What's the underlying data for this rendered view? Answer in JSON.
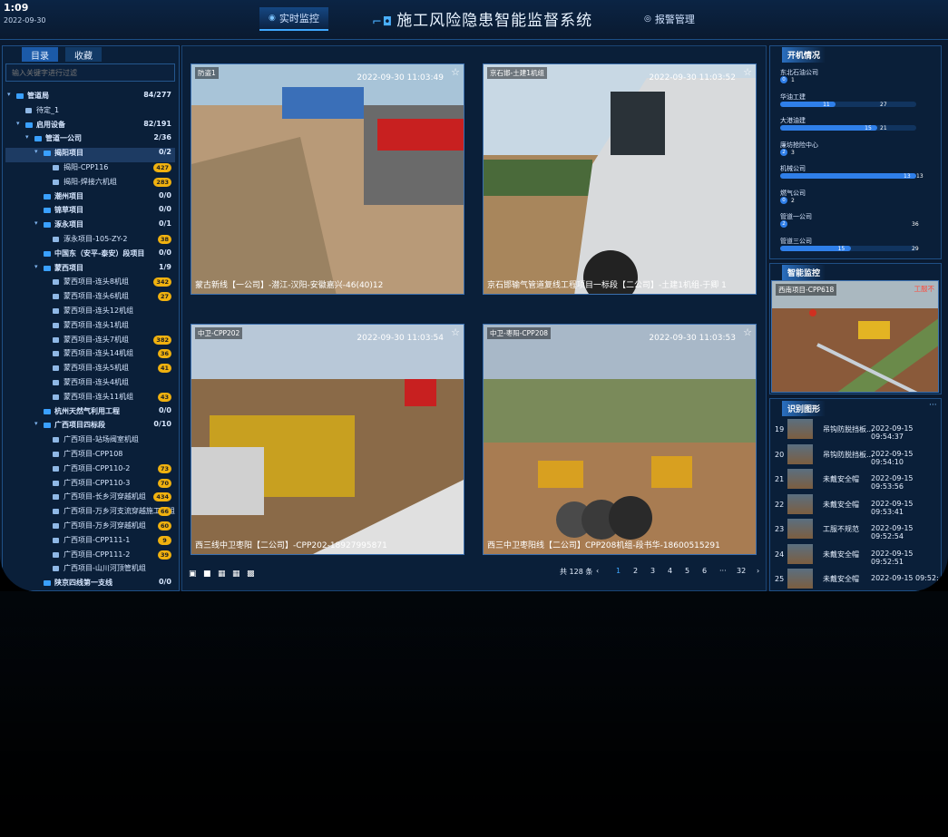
{
  "clock": {
    "time": "1:09",
    "date": "2022-09-30"
  },
  "nav": {
    "realtime": "实时监控",
    "alarm": "报警管理"
  },
  "app_title": "施工风险隐患智能监督系统",
  "left": {
    "tabs": [
      "目录",
      "收藏"
    ],
    "filter_placeholder": "输入关键字进行过滤",
    "tree": [
      {
        "label": "管道局",
        "count": "84/277",
        "level": 0,
        "caret": true
      },
      {
        "label": "待定_1",
        "level": 1,
        "leaf": true
      },
      {
        "label": "启用设备",
        "count": "82/191",
        "level": 1,
        "caret": true
      },
      {
        "label": "管道一公司",
        "count": "2/36",
        "level": 2,
        "caret": true
      },
      {
        "label": "揭阳项目",
        "count": "0/2",
        "level": 3,
        "caret": true,
        "selected": true
      },
      {
        "label": "揭阳-CPP116",
        "badge": "427",
        "level": 4,
        "leaf": true
      },
      {
        "label": "揭阳-焊接六机组",
        "badge": "283",
        "level": 4,
        "leaf": true
      },
      {
        "label": "潮州项目",
        "count": "0/0",
        "level": 3
      },
      {
        "label": "锦草项目",
        "count": "0/0",
        "level": 3
      },
      {
        "label": "涿永项目",
        "count": "0/1",
        "level": 3,
        "caret": true
      },
      {
        "label": "涿永项目-105-ZY-2",
        "badge": "38",
        "level": 4,
        "leaf": true
      },
      {
        "label": "中国东（安平-泰安）段项目",
        "count": "0/0",
        "level": 3
      },
      {
        "label": "蒙西项目",
        "count": "1/9",
        "level": 3,
        "caret": true
      },
      {
        "label": "蒙西项目-连头8机组",
        "badge": "342",
        "level": 4,
        "leaf": true
      },
      {
        "label": "蒙西项目-连头6机组",
        "badge": "27",
        "level": 4,
        "leaf": true
      },
      {
        "label": "蒙西项目-连头12机组",
        "level": 4,
        "leaf": true
      },
      {
        "label": "蒙西项目-连头1机组",
        "level": 4,
        "leaf": true
      },
      {
        "label": "蒙西项目-连头7机组",
        "badge": "382",
        "level": 4,
        "leaf": true
      },
      {
        "label": "蒙西项目-连头14机组",
        "badge": "36",
        "level": 4,
        "leaf": true
      },
      {
        "label": "蒙西项目-连头5机组",
        "badge": "41",
        "level": 4,
        "leaf": true
      },
      {
        "label": "蒙西项目-连头4机组",
        "level": 4,
        "leaf": true
      },
      {
        "label": "蒙西项目-连头11机组",
        "badge": "43",
        "level": 4,
        "leaf": true
      },
      {
        "label": "杭州天然气利用工程",
        "count": "0/0",
        "level": 3
      },
      {
        "label": "广西项目四标段",
        "count": "0/10",
        "level": 3,
        "caret": true
      },
      {
        "label": "广西项目-站场阀室机组",
        "level": 4,
        "leaf": true
      },
      {
        "label": "广西项目-CPP108",
        "level": 4,
        "leaf": true
      },
      {
        "label": "广西项目-CPP110-2",
        "badge": "73",
        "level": 4,
        "leaf": true
      },
      {
        "label": "广西项目-CPP110-3",
        "badge": "70",
        "level": 4,
        "leaf": true
      },
      {
        "label": "广西项目-长乡河穿越机组",
        "badge": "434",
        "level": 4,
        "leaf": true
      },
      {
        "label": "广西项目-万乡河支流穿越施工机组",
        "badge": "66",
        "level": 4,
        "leaf": true
      },
      {
        "label": "广西项目-万乡河穿越机组",
        "badge": "60",
        "level": 4,
        "leaf": true
      },
      {
        "label": "广西项目-CPP111-1",
        "badge": "9",
        "level": 4,
        "leaf": true
      },
      {
        "label": "广西项目-CPP111-2",
        "badge": "39",
        "level": 4,
        "leaf": true
      },
      {
        "label": "广西项目-山川河顶管机组",
        "level": 4,
        "leaf": true
      },
      {
        "label": "陕京四线第一支线",
        "count": "0/0",
        "level": 3
      }
    ]
  },
  "cameras": [
    {
      "label": "防盗1",
      "time": "2022-09-30 11:03:49",
      "caption": "蒙古新线【一公司】-潜江-汉阳-安徽嘉兴-46(40)12",
      "scene": "site"
    },
    {
      "label": "京石邯-土建1机组",
      "time": "2022-09-30 11:03:52",
      "caption": "京石邯输气管道复线工程项目一标段【二公司】-土建1机组-于卿 1",
      "scene": "truck"
    },
    {
      "label": "中卫-CPP202",
      "time": "2022-09-30 11:03:54",
      "caption": "西三线中卫枣阳【二公司】-CPP202-18927995871",
      "scene": "machine"
    },
    {
      "label": "中卫-枣阳-CPP208",
      "time": "2022-09-30 11:03:53",
      "caption": "西三中卫枣阳线【二公司】CPP208机组-段书华-18600515291",
      "scene": "pipes"
    }
  ],
  "pager": {
    "total": "共 128 条",
    "pages": [
      "1",
      "2",
      "3",
      "4",
      "5",
      "6",
      "···",
      "32"
    ],
    "prev": "‹",
    "next": "›"
  },
  "right": {
    "status_title": "开机情况",
    "status": [
      {
        "name": "东北石油公司",
        "on": 0,
        "total": 1
      },
      {
        "name": "华油工建",
        "on": 11,
        "total": 27
      },
      {
        "name": "大港油建",
        "on": 15,
        "total": 21
      },
      {
        "name": "廉坊抢险中心",
        "on": 2,
        "total": 3
      },
      {
        "name": "机械公司",
        "on": 13,
        "total": 13
      },
      {
        "name": "燃气公司",
        "on": 0,
        "total": 2
      },
      {
        "name": "管道一公司",
        "on": 2,
        "total": 36
      },
      {
        "name": "管道三公司",
        "on": 15,
        "total": 29
      }
    ],
    "smart_title": "智能监控",
    "smart_cam": {
      "label": "西南项目-CPP618",
      "tag": "工服不"
    },
    "rec_title": "识别图形",
    "more": "···",
    "records": [
      {
        "idx": "19",
        "type": "吊钩防脱挡板...",
        "time": "2022-09-15 09:54:37"
      },
      {
        "idx": "20",
        "type": "吊钩防脱挡板...",
        "time": "2022-09-15 09:54:10"
      },
      {
        "idx": "21",
        "type": "未戴安全帽",
        "time": "2022-09-15 09:53:56"
      },
      {
        "idx": "22",
        "type": "未戴安全帽",
        "time": "2022-09-15 09:53:41"
      },
      {
        "idx": "23",
        "type": "工服不规范",
        "time": "2022-09-15 09:52:54"
      },
      {
        "idx": "24",
        "type": "未戴安全帽",
        "time": "2022-09-15 09:52:51"
      },
      {
        "idx": "25",
        "type": "未戴安全帽",
        "time": "2022-09-15 09:52:"
      }
    ]
  },
  "colors": {
    "accent": "#2f7fe9",
    "badge": "#f0b10f",
    "bg": "#0a1a30"
  }
}
